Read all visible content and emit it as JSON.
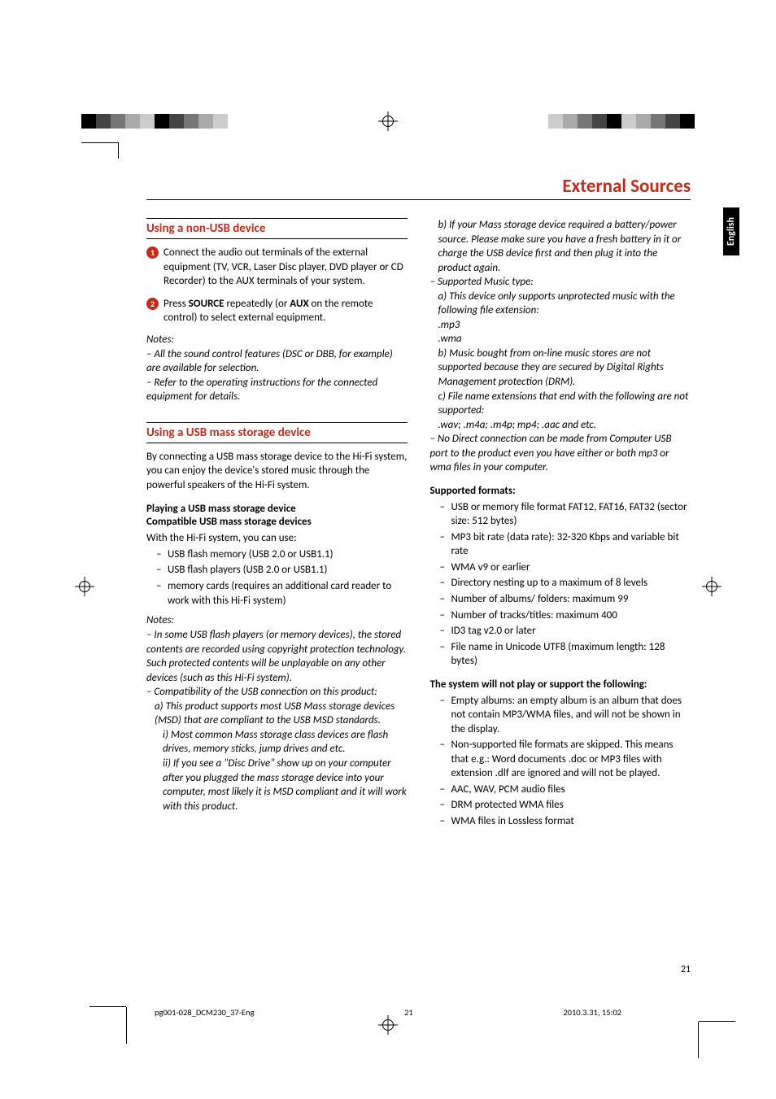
{
  "page_title": "External Sources",
  "language_tab": "English",
  "page_number": "21",
  "footer": {
    "file": "pg001-028_DCM230_37-Eng",
    "page": "21",
    "timestamp": "2010.3.31, 15:02"
  },
  "left": {
    "h_non_usb": "Using a non-USB device",
    "step1": "Connect the audio out terminals of the external equipment (TV, VCR, Laser Disc player, DVD player or CD Recorder) to the AUX terminals of your system.",
    "step2_pre": "Press ",
    "step2_src": "SOURCE",
    "step2_mid": " repeatedly (or ",
    "step2_aux": "AUX",
    "step2_post": " on the remote control) to select external equipment.",
    "notes_label": "Notes:",
    "note1_dash": "–   ",
    "note1": "All the sound control features (DSC or DBB, for example) are available for selection.",
    "note2_dash": "–   ",
    "note2": "Refer to the operating instructions for the connected equipment for details.",
    "h_usb": "Using a USB mass storage device",
    "usb_intro": "By connecting a USB mass storage device to the Hi-Fi system, you can enjoy the device's stored music through the powerful speakers of the Hi-Fi system.",
    "play_head1": "Playing a USB mass storage device",
    "play_head2": "Compatible USB mass storage devices",
    "play_lead": "With the Hi-Fi system, you can use:",
    "play_b1": "USB flash memory (USB 2.0 or USB1.1)",
    "play_b2": "USB flash players (USB 2.0 or USB1.1)",
    "play_b3": "memory cards (requires an additional card reader to work with this Hi-Fi system)",
    "notes2_label": "Notes:",
    "n2_1_dash": "–   ",
    "n2_1": "In some USB flash players (or memory devices), the stored contents are recorded using copyright protection technology. Such protected contents will be unplayable on any other devices (such as this Hi-Fi system).",
    "n2_2_dash": "–   ",
    "n2_2": "Compatibility of the USB connection on this product:",
    "n2_2a": "a) This product supports most USB Mass storage devices (MSD) that are compliant to the USB MSD standards.",
    "n2_2a_i": "i) Most common Mass storage class devices are flash drives, memory sticks, jump drives and etc.",
    "n2_2a_ii": "ii) If you see a \"Disc Drive\" show up on your computer after you plugged the mass storage device into your computer, most likely it is MSD compliant and it will work with this product."
  },
  "right": {
    "n2_2b": "b) If your Mass storage device required a battery/power source. Please make sure you have a fresh battery in it or charge the USB device first and then plug it into the product again.",
    "n2_3_dash": "–   ",
    "n2_3": "Supported Music type:",
    "n2_3a": "a) This device only supports unprotected music with the following file extension:",
    "ext_mp3": ".mp3",
    "ext_wma": ".wma",
    "n2_3b": "b) Music bought from on-line music stores are not supported because they are secured by Digital Rights Management protection (DRM).",
    "n2_3c": "c) File name extensions that end with the following are not supported:",
    "n2_3c_exts": ".wav; .m4a; .m4p; mp4; .aac and etc.",
    "n2_4_dash": "–   ",
    "n2_4": "No Direct connection can be made from Computer USB port to the product even you have either or both mp3 or wma files in your computer.",
    "supp_head": "Supported formats:",
    "s1": "USB or memory file format FAT12, FAT16, FAT32 (sector size: 512 bytes)",
    "s2": "MP3 bit rate (data rate): 32-320 Kbps and variable bit rate",
    "s3": "WMA v9 or earlier",
    "s4": "Directory nesting up to a maximum of 8 levels",
    "s5": "Number of albums/ folders: maximum 99",
    "s6": "Number of tracks/titles: maximum 400",
    "s7": "ID3 tag v2.0 or later",
    "s8": "File name in Unicode UTF8 (maximum length: 128 bytes)",
    "noplay_head": "The system will not play or support the following:",
    "np1": "Empty albums: an empty album is an album that does not contain MP3/WMA files, and will not be shown in the display.",
    "np2": "Non-supported file formats are skipped. This means that e.g.: Word documents .doc or MP3 files with extension .dlf are ignored and will not be played.",
    "np3": "AAC, WAV, PCM audio files",
    "np4": "DRM protected WMA files",
    "np5": "WMA files in Lossless format"
  }
}
